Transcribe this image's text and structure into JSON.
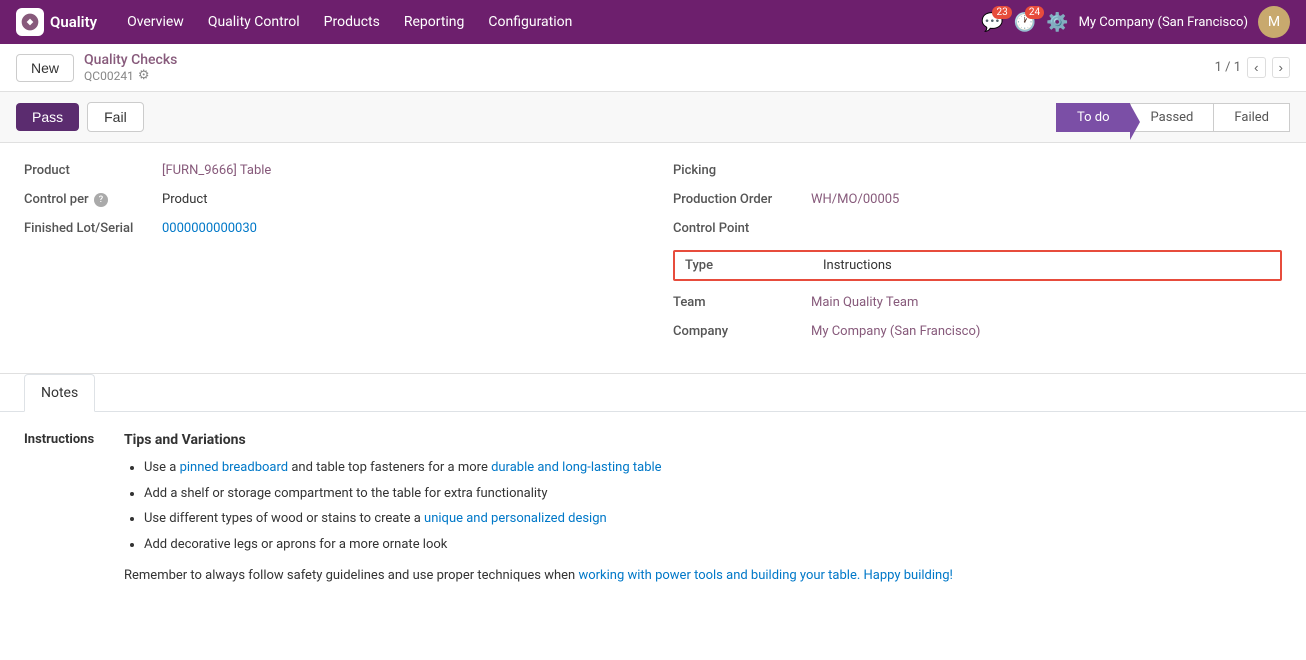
{
  "nav": {
    "logo_text": "Quality",
    "items": [
      "Overview",
      "Quality Control",
      "Products",
      "Reporting",
      "Configuration"
    ],
    "notifications_count": "23",
    "activity_count": "24",
    "company": "My Company (San Francisco)",
    "avatar_initials": "M"
  },
  "sub_header": {
    "new_label": "New",
    "breadcrumb_title": "Quality Checks",
    "breadcrumb_sub": "QC00241",
    "pagination": "1 / 1"
  },
  "action_bar": {
    "pass_label": "Pass",
    "fail_label": "Fail",
    "status_steps": [
      "To do",
      "Passed",
      "Failed"
    ]
  },
  "form": {
    "left": {
      "product_label": "Product",
      "product_value": "[FURN_9666] Table",
      "control_per_label": "Control per",
      "control_per_value": "Product",
      "lot_serial_label": "Finished Lot/Serial",
      "lot_serial_value": "0000000000030"
    },
    "right": {
      "picking_label": "Picking",
      "picking_value": "",
      "production_order_label": "Production Order",
      "production_order_value": "WH/MO/00005",
      "control_point_label": "Control Point",
      "control_point_value": "",
      "type_label": "Type",
      "type_value": "Instructions",
      "team_label": "Team",
      "team_value": "Main Quality Team",
      "company_label": "Company",
      "company_value": "My Company (San Francisco)"
    }
  },
  "notes_tab": {
    "tab_label": "Notes",
    "instructions_label": "Instructions",
    "heading": "Tips and Variations",
    "bullets": [
      "Use a pinned breadboard and table top fasteners for a more durable and long-lasting table",
      "Add a shelf or storage compartment to the table for extra functionality",
      "Use different types of wood or stains to create a unique and personalized design",
      "Add decorative legs or aprons for a more ornate look"
    ],
    "footer_text": "Remember to always follow safety guidelines and use proper techniques when working with power tools and building your table. Happy building!"
  }
}
